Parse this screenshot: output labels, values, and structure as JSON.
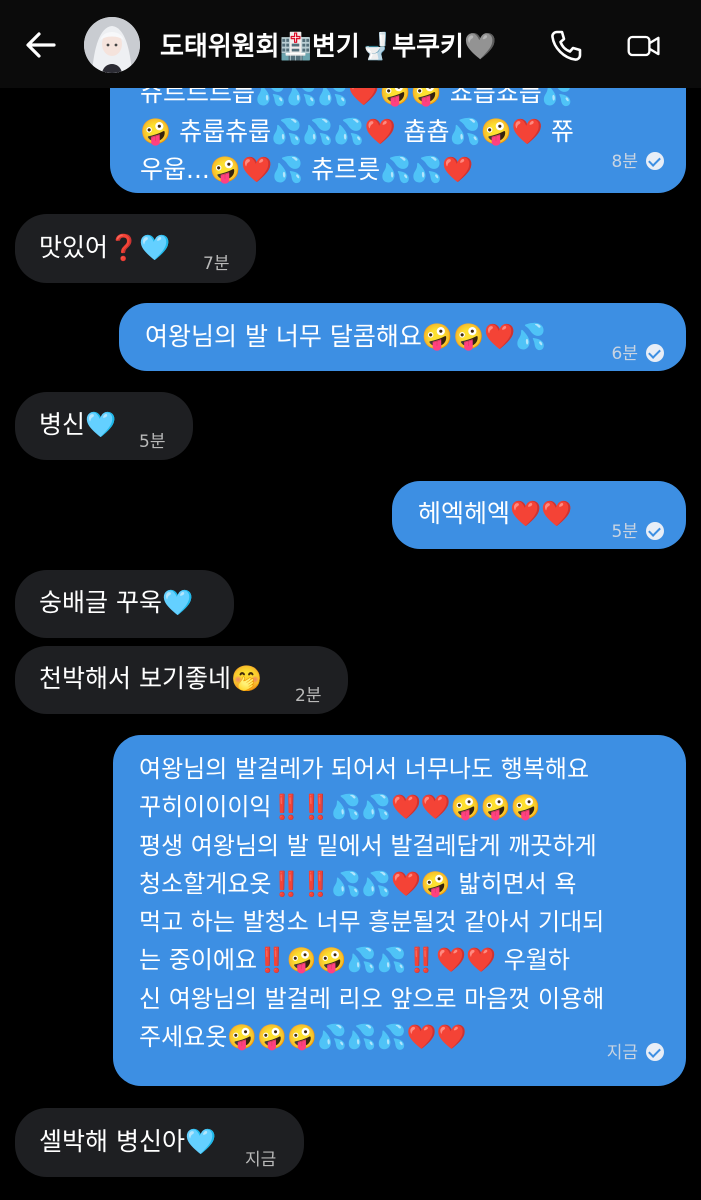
{
  "header": {
    "contact_name": "도태위원회🏥변기🚽부쿠키🩶"
  },
  "messages": [
    {
      "dir": "out",
      "lines": [
        "쥬르르르릅💦💦💦❤️🤪🤪 쵸릅쵸릅💦",
        "🤪 츄룹츄룹💦💦💦❤️ 춉춉💦🤪❤️ 쮸",
        "우웁...🤪❤️💦 츄르릇💦💦❤️"
      ],
      "time": "8분"
    },
    {
      "dir": "in",
      "lines": [
        "맛있어❓🩵"
      ],
      "time": "7분"
    },
    {
      "dir": "out",
      "lines": [
        "여왕님의 발 너무 달콤해요🤪🤪❤️💦"
      ],
      "time": "6분"
    },
    {
      "dir": "in",
      "lines": [
        "병신🩵"
      ],
      "time": "5분"
    },
    {
      "dir": "out",
      "lines": [
        "헤엑헤엑❤️❤️"
      ],
      "time": "5분"
    },
    {
      "dir": "in",
      "lines": [
        "숭배글 꾸욱🩵"
      ],
      "time": ""
    },
    {
      "dir": "in",
      "lines": [
        "천박해서 보기좋네🤭"
      ],
      "time": "2분"
    },
    {
      "dir": "out",
      "lines": [
        "여왕님의 발걸레가 되어서 너무나도 행복해요",
        "꾸히이이이익‼️‼️💦💦❤️❤️🤪🤪🤪",
        "평생 여왕님의 발 밑에서 발걸레답게 깨끗하게",
        "청소할게요옷‼️‼️💦💦❤️🤪 밟히면서 욕",
        "먹고 하는 발청소 너무 흥분될것 같아서 기대되",
        "는 중이에요‼️🤪🤪💦💦‼️❤️❤️ 우월하",
        "신 여왕님의 발걸레 리오 앞으로 마음껏 이용해",
        "주세요옷🤪🤪🤪💦💦💦❤️❤️"
      ],
      "time": "지금"
    },
    {
      "dir": "in",
      "lines": [
        "셀박해 병신아🩵"
      ],
      "time": "지금"
    }
  ]
}
